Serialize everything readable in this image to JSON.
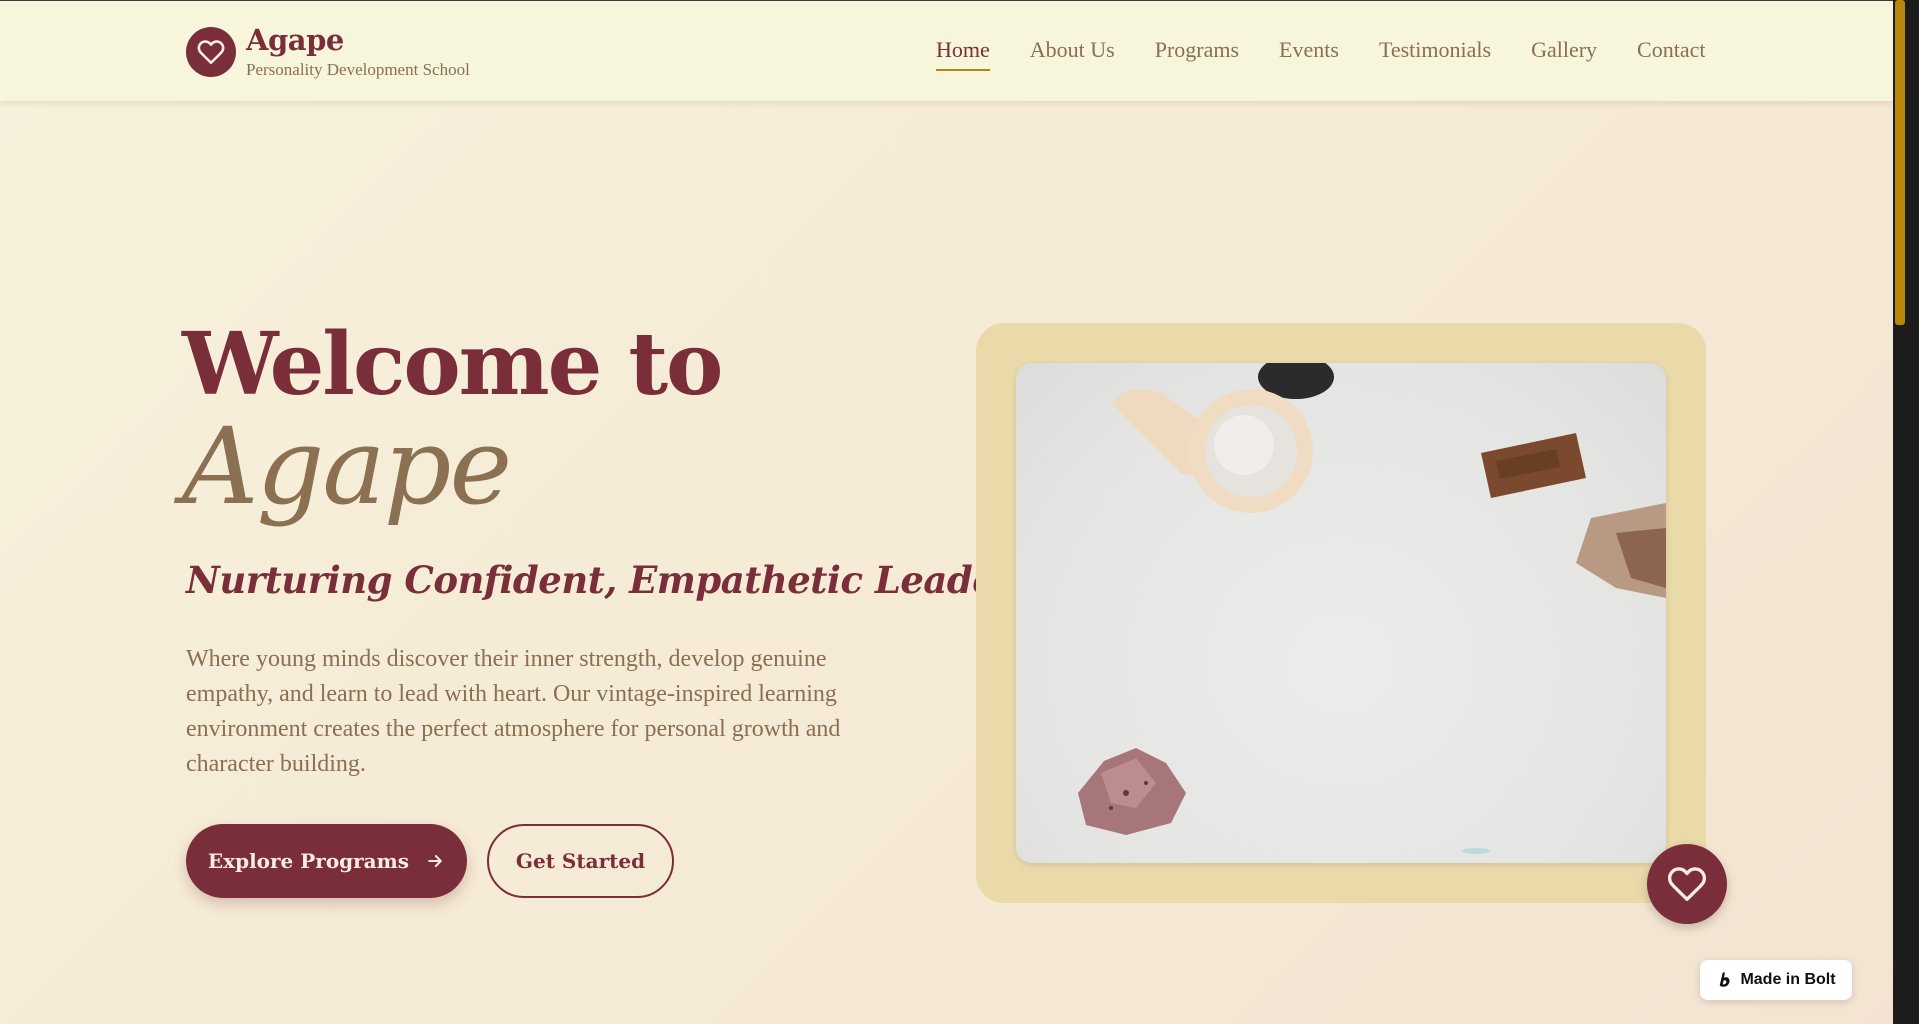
{
  "brand": {
    "name": "Agape",
    "tagline": "Personality Development School"
  },
  "nav": {
    "items": [
      {
        "label": "Home",
        "active": true
      },
      {
        "label": "About Us"
      },
      {
        "label": "Programs"
      },
      {
        "label": "Events"
      },
      {
        "label": "Testimonials"
      },
      {
        "label": "Gallery"
      },
      {
        "label": "Contact"
      }
    ]
  },
  "hero": {
    "title": "Welcome to",
    "script": "Agape",
    "subtitle": "Nurturing Confident, Empathetic Leaders",
    "description": "Where young minds discover their inner strength, develop genuine empathy, and learn to lead with heart. Our vintage-inspired learning environment creates the perfect atmosphere for personal growth and character building.",
    "primary_button": "Explore Programs",
    "secondary_button": "Get Started"
  },
  "badge": {
    "label": "Made in Bolt"
  },
  "icons": {
    "logo": "heart-icon",
    "arrow": "arrow-right-icon",
    "badge": "heart-icon",
    "bolt": "bolt-logo-icon"
  },
  "colors": {
    "primary": "#7a2e3a",
    "accent": "#b8860b",
    "muted": "#8a6f52",
    "frame": "#ead9a9",
    "nav_bg": "#f7f6dc"
  }
}
